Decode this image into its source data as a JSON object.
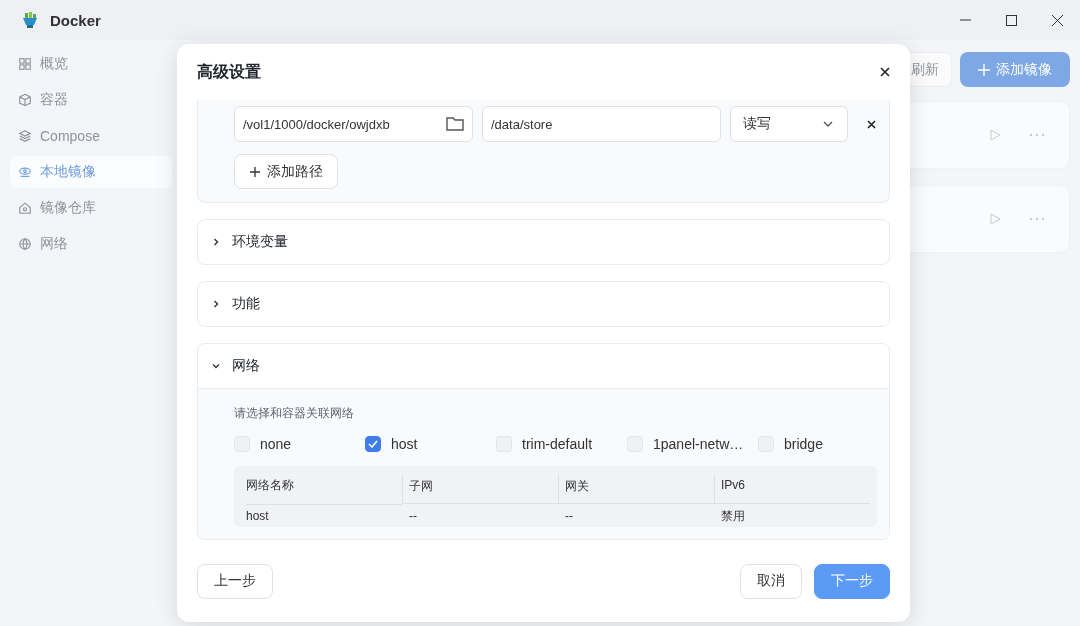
{
  "window": {
    "title": "Docker"
  },
  "sidebar": {
    "items": [
      {
        "label": "概览",
        "selected": false
      },
      {
        "label": "容器",
        "selected": false
      },
      {
        "label": "Compose",
        "selected": false
      },
      {
        "label": "本地镜像",
        "selected": true
      },
      {
        "label": "镜像仓库",
        "selected": false
      },
      {
        "label": "网络",
        "selected": false
      }
    ]
  },
  "toolbar": {
    "buttons": [
      {
        "label": "刷新",
        "kind": "secondary"
      },
      {
        "label": "添加镜像",
        "kind": "primary"
      }
    ]
  },
  "image_rows": [
    {
      "kind": "image"
    },
    {
      "kind": "image"
    }
  ],
  "dialog": {
    "title": "高级设置",
    "volume": {
      "host_path": "/vol1/1000/docker/owjdxb",
      "container_path": "/data/store",
      "mode": "读写",
      "add_button": "添加路径"
    },
    "sections": [
      {
        "title": "环境变量",
        "expanded": false
      },
      {
        "title": "功能",
        "expanded": false
      },
      {
        "title": "网络",
        "expanded": true,
        "hint": "请选择和容器关联网络",
        "networks": [
          {
            "label": "none",
            "checked": false
          },
          {
            "label": "host",
            "checked": true
          },
          {
            "label": "trim-default",
            "checked": false
          },
          {
            "label": "1panel-netw…",
            "checked": false
          },
          {
            "label": "bridge",
            "checked": false
          }
        ],
        "table": {
          "columns": [
            "网络名称",
            "子网",
            "网关",
            "IPv6"
          ],
          "rows": [
            [
              "host",
              "--",
              "--",
              "禁用"
            ]
          ]
        }
      }
    ],
    "buttons": [
      {
        "label": "上一步",
        "kind": "back"
      },
      {
        "label": "取消",
        "kind": "cancel"
      },
      {
        "label": "下一步",
        "kind": "primary"
      }
    ]
  }
}
